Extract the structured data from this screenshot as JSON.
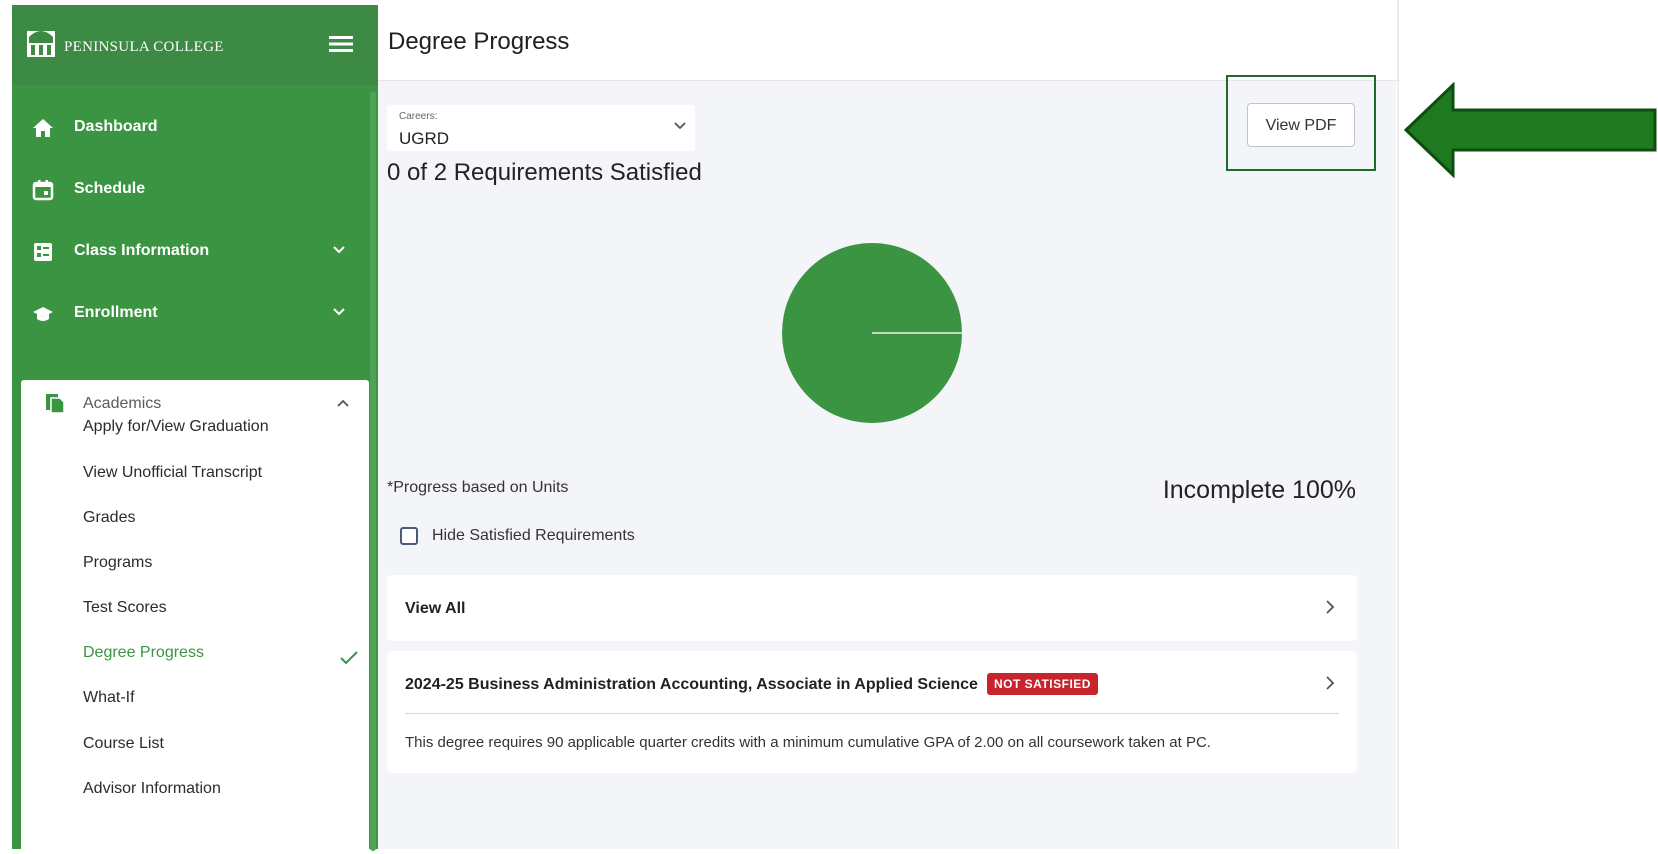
{
  "brand": {
    "name": "PENINSULA COLLEGE"
  },
  "nav": {
    "items": [
      {
        "label": "Dashboard",
        "icon": "home-icon"
      },
      {
        "label": "Schedule",
        "icon": "calendar-icon"
      },
      {
        "label": "Class Information",
        "icon": "list-icon"
      },
      {
        "label": "Enrollment",
        "icon": "graduation-cap-icon"
      }
    ],
    "academics": {
      "label": "Academics",
      "items": [
        "Apply for/View Graduation",
        "View Unofficial Transcript",
        "Grades",
        "Programs",
        "Test Scores",
        "Degree Progress",
        "What-If",
        "Course List",
        "Advisor Information"
      ],
      "active": "Degree Progress"
    }
  },
  "header": {
    "title": "Degree Progress"
  },
  "careers": {
    "caption": "Careers:",
    "value": "UGRD"
  },
  "summary": {
    "requirements": "0 of 2 Requirements Satisfied"
  },
  "view_pdf_label": "View PDF",
  "progress": {
    "note": "*Progress based on Units",
    "incomplete_label": "Incomplete 100%",
    "incomplete_percent": 100
  },
  "filter": {
    "hide_satisfied_label": "Hide Satisfied Requirements",
    "checked": false
  },
  "cards": {
    "view_all": "View All",
    "degree": {
      "title": "2024-25 Business Administration Accounting, Associate in Applied Science",
      "badge": "NOT SATISFIED",
      "description": "This degree requires 90 applicable quarter credits with a minimum cumulative GPA of 2.00 on all coursework taken at PC."
    }
  },
  "colors": {
    "sidebar_green": "#3b9442",
    "pie_green": "#3b9442",
    "badge_red": "#c8242b",
    "arrow_green": "#1f7a1f"
  }
}
